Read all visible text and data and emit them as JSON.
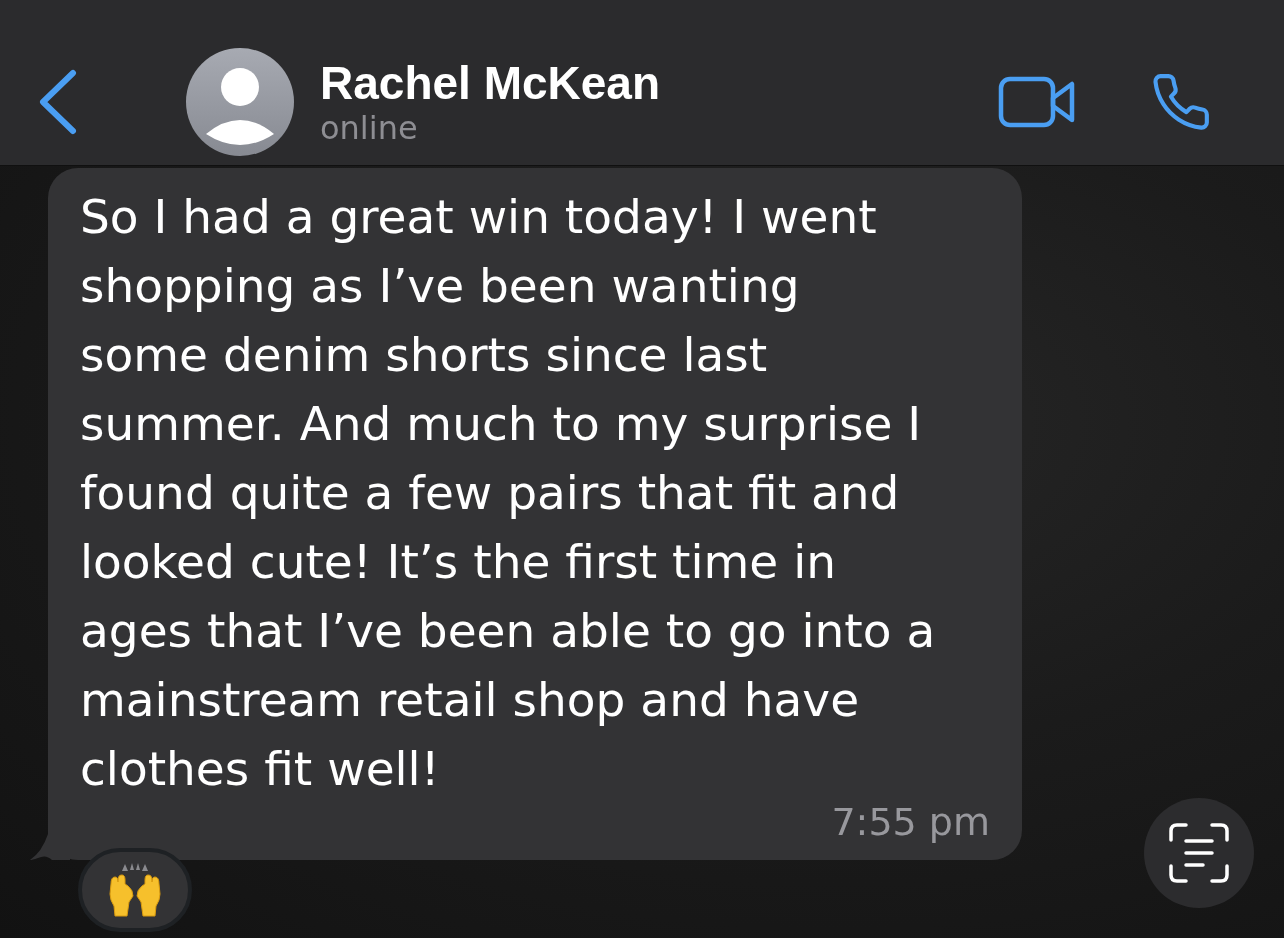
{
  "contact": {
    "name": "Rachel McKean",
    "status": "online"
  },
  "messages": [
    {
      "text": "So I had a great win today! I went\nshopping as I’ve been wanting\nsome denim shorts since last\nsummer. And much to my surprise I\nfound quite a few pairs that fit and\nlooked cute! It’s the first time in\nages that I’ve been able to go into a\nmainstream retail shop and have\nclothes fit well!",
      "time": "7:55 pm",
      "reactions": [
        {
          "kind": "raised-hands"
        }
      ]
    }
  ]
}
